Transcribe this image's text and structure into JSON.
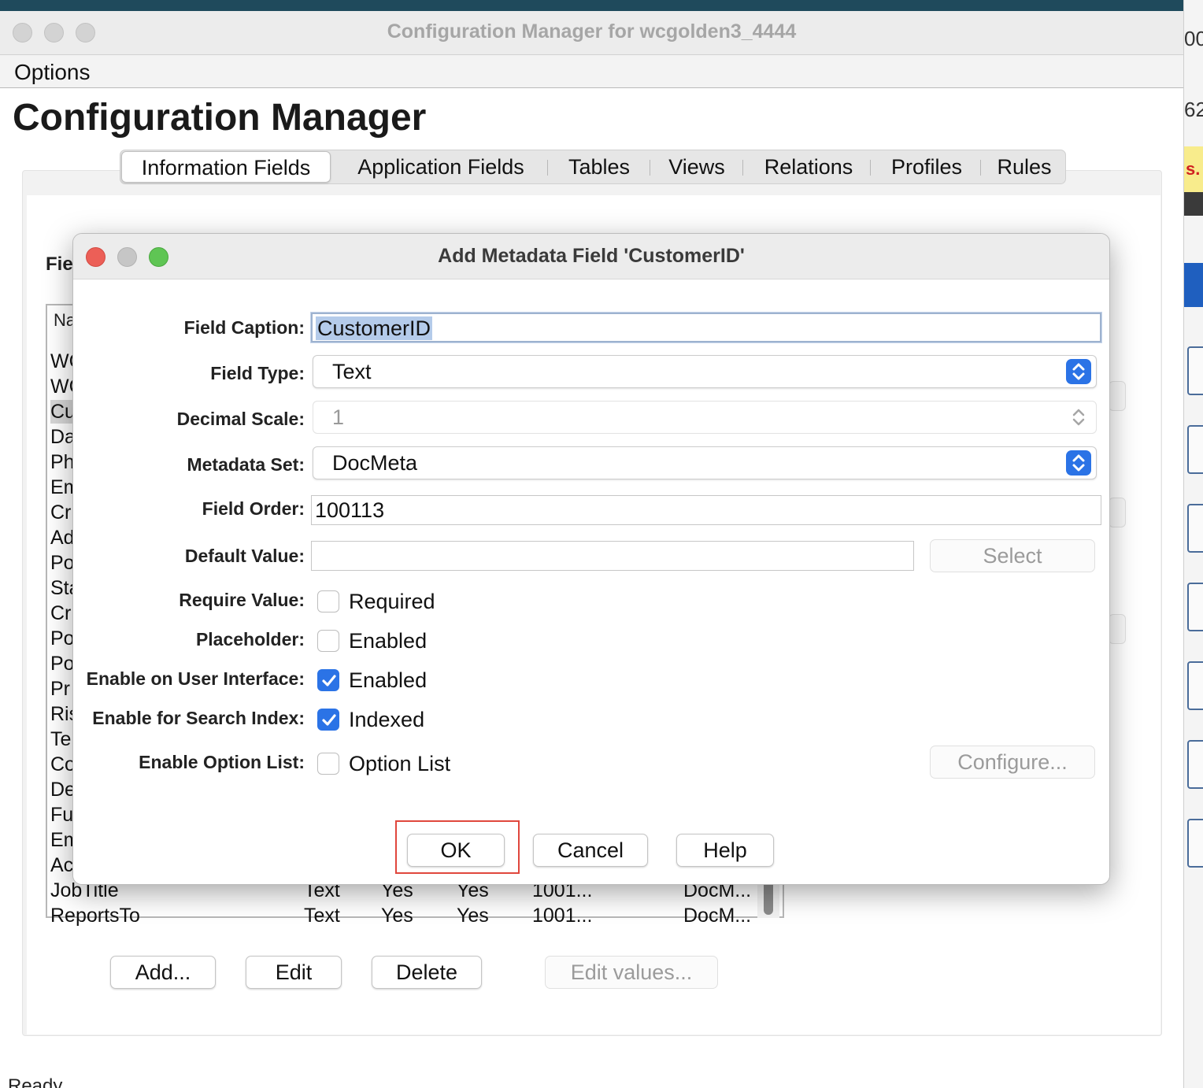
{
  "window": {
    "title": "Configuration Manager for wcgolden3_4444",
    "menu": [
      "Options"
    ],
    "page_title": "Configuration Manager"
  },
  "tabs": [
    {
      "label": "Information Fields",
      "active": true
    },
    {
      "label": "Application Fields"
    },
    {
      "label": "Tables"
    },
    {
      "label": "Views"
    },
    {
      "label": "Relations"
    },
    {
      "label": "Profiles"
    },
    {
      "label": "Rules"
    }
  ],
  "fields_panel": {
    "label": "Fie",
    "list_header": "Na",
    "partial_rows": [
      "WC",
      "WC",
      "Cu",
      "Da",
      "Ph",
      "Em",
      "Cr",
      "Ad",
      "Po",
      "Sta",
      "Cr",
      "Po",
      "Po",
      "Pr",
      "Ris",
      "Te",
      "Co",
      "De",
      "Fu",
      "Em",
      "Ac"
    ],
    "full_rows": [
      {
        "name": "JobTitle",
        "type": "Text",
        "enabled": "Yes",
        "indexed": "Yes",
        "order": "1001...",
        "set": "DocM..."
      },
      {
        "name": "ReportsTo",
        "type": "Text",
        "enabled": "Yes",
        "indexed": "Yes",
        "order": "1001...",
        "set": "DocM..."
      }
    ],
    "buttons": {
      "add": "Add...",
      "edit": "Edit",
      "delete": "Delete",
      "edit_values": "Edit values..."
    }
  },
  "status": {
    "text": "Ready"
  },
  "right_edge": {
    "text_top": "00",
    "text_mid": "62",
    "text_yellow": "s."
  },
  "dialog": {
    "title": "Add Metadata Field 'CustomerID'",
    "labels": {
      "caption": "Field Caption:",
      "type": "Field Type:",
      "decimal": "Decimal Scale:",
      "metadata_set": "Metadata Set:",
      "order": "Field Order:",
      "default_value": "Default Value:",
      "require": "Require Value:",
      "placeholder": "Placeholder:",
      "enable_ui": "Enable on User Interface:",
      "enable_search": "Enable for Search Index:",
      "enable_option": "Enable Option List:"
    },
    "values": {
      "caption": "CustomerID",
      "type": "Text",
      "decimal": "1",
      "metadata_set": "DocMeta",
      "order": "100113",
      "default_value": ""
    },
    "checkboxes": {
      "require": {
        "label": "Required",
        "checked": false
      },
      "placeholder": {
        "label": "Enabled",
        "checked": false
      },
      "enable_ui": {
        "label": "Enabled",
        "checked": true
      },
      "enable_search": {
        "label": "Indexed",
        "checked": true
      },
      "enable_option": {
        "label": "Option List",
        "checked": false
      }
    },
    "buttons": {
      "select": "Select",
      "configure": "Configure...",
      "ok": "OK",
      "cancel": "Cancel",
      "help": "Help"
    }
  },
  "colors": {
    "accent": "#2b73e6",
    "highlight": "#e0473d",
    "close": "#ec5f57",
    "minimize": "#c6c6c6",
    "zoom": "#5fc554"
  }
}
